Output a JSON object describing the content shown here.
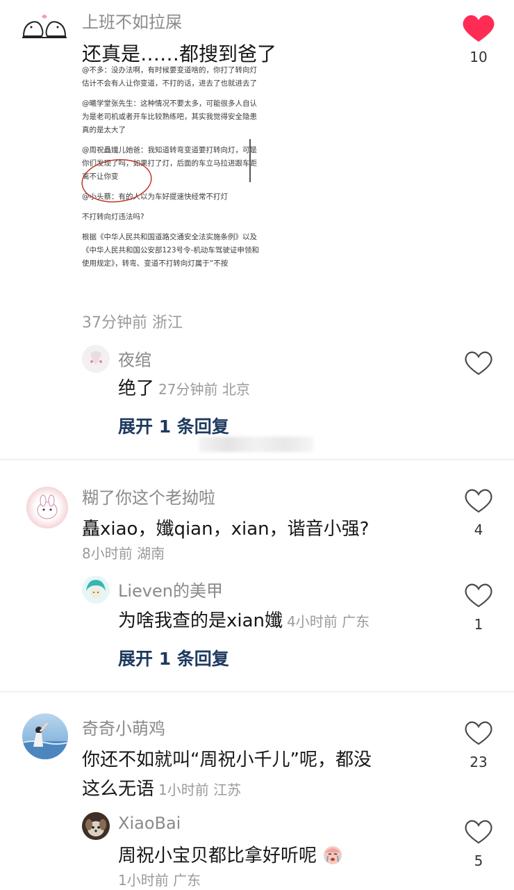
{
  "comments": [
    {
      "username": "上班不如拉屎",
      "text": "还真是……都搜到爸了",
      "meta": "37分钟前 浙江",
      "likes": "10",
      "liked": true,
      "image_lines": [
        "@不多：没办法啊，有时候要变道啥的，你打了转向灯估计不会有人让你变道，不打的话，进去了也就进去了",
        "@曦学堂张先生：这种情况不要太多，可能很多人自认为是老司机或者开车比较熟练吧，其实我觉得安全隐患真的是太大了",
        "@周祝矗孅儿她爸：我知道转弯变道要打转向灯，可是你们发现了吗，如果打了灯，后面的车立马拉进跟车距离不让你变",
        "@小头蔡：有的人以为车好提速快经常不打灯",
        "不打转向灯违法吗?",
        "根据《中华人民共和国道路交通安全法实施条例》以及《中华人民共和国公安部123号令-机动车驾驶证申领和使用规定》，转弯、变道不打转向灯属于“不按"
      ],
      "replies": [
        {
          "username": "夜绾",
          "text": "绝了",
          "meta": "27分钟前 北京",
          "likes": ""
        }
      ],
      "expand_label": "展开 1 条回复"
    },
    {
      "username": "糊了你这个老拗啦",
      "text": "矗xiao，孅qian，xian，谐音小强?",
      "meta": "8小时前 湖南",
      "likes": "4",
      "replies": [
        {
          "username": "Lieven的美甲",
          "text": "为啥我查的是xian孅",
          "meta": "4小时前 广东",
          "likes": "1"
        }
      ],
      "expand_label": "展开 1 条回复"
    },
    {
      "username": "奇奇小萌鸡",
      "text_line1": "你还不如就叫“周祝小千儿”呢，都没",
      "text_line2": "这么无语",
      "meta": "1小时前 江苏",
      "likes": "23",
      "replies": [
        {
          "username": "XiaoBai",
          "text": "周祝小宝贝都比拿好听呢",
          "meta": "1小时前 广东",
          "likes": "5"
        }
      ]
    }
  ],
  "colors": {
    "heart_liked": "#fe2c55",
    "expand": "#1f3a60"
  }
}
